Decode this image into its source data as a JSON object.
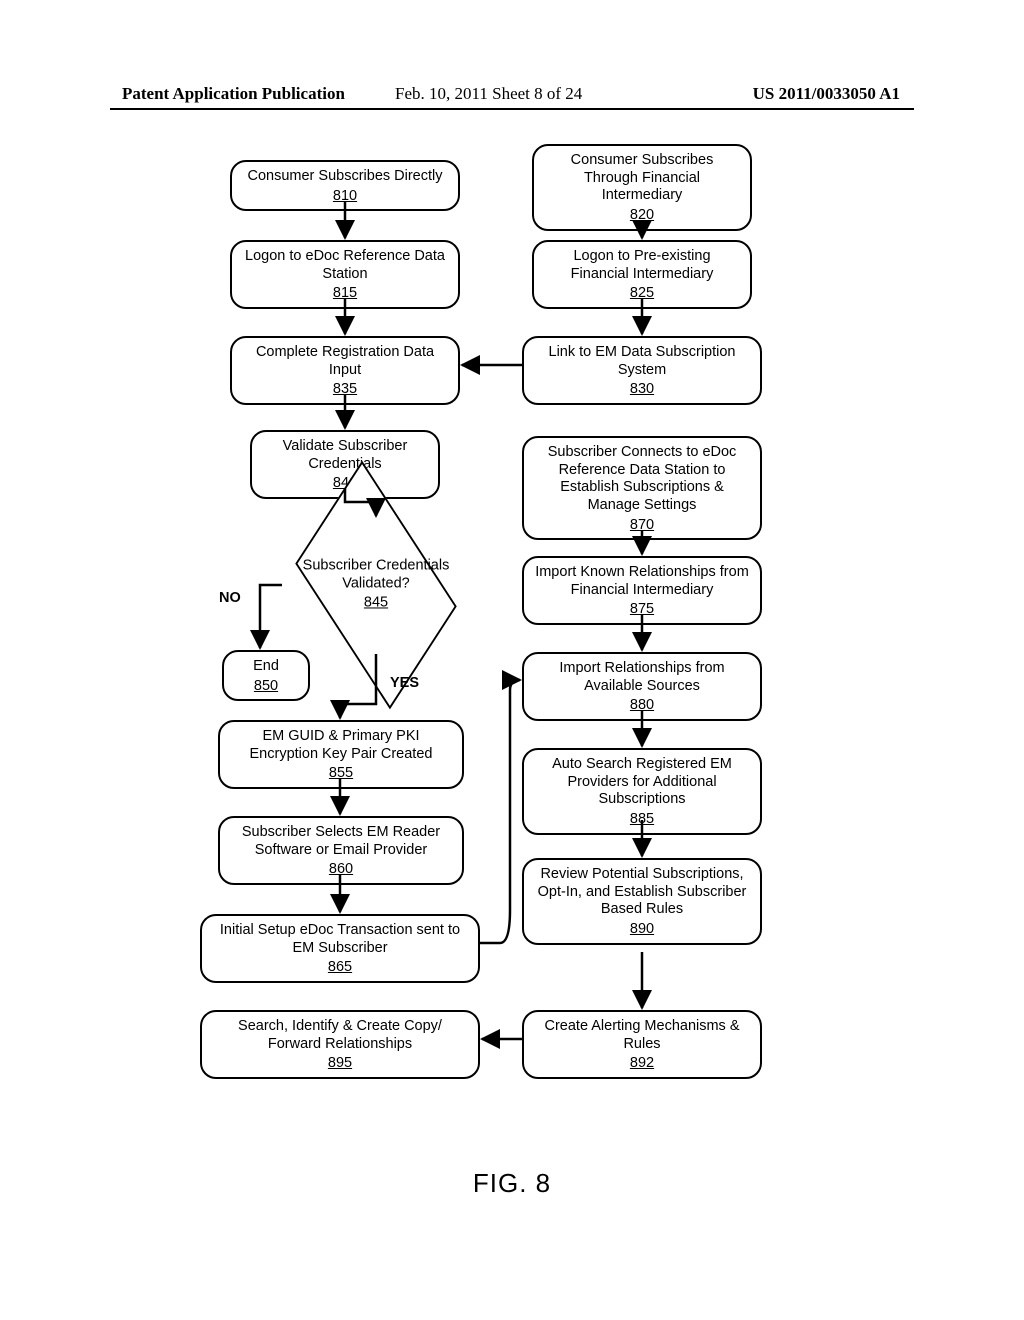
{
  "header": {
    "left": "Patent Application Publication",
    "center": "Feb. 10, 2011  Sheet 8 of 24",
    "right": "US 2011/0033050 A1"
  },
  "figure_label": "FIG. 8",
  "labels": {
    "no": "NO",
    "yes": "YES"
  },
  "boxes": {
    "b810": {
      "text": "Consumer Subscribes Directly",
      "ref": "810"
    },
    "b815": {
      "text": "Logon to eDoc Reference Data Station",
      "ref": "815"
    },
    "b820": {
      "text": "Consumer Subscribes Through Financial Intermediary",
      "ref": "820"
    },
    "b825": {
      "text": "Logon to Pre-existing Financial Intermediary",
      "ref": "825"
    },
    "b830": {
      "text": "Link to EM Data Subscription System",
      "ref": "830"
    },
    "b835": {
      "text": "Complete Registration Data Input",
      "ref": "835"
    },
    "b840": {
      "text": "Validate Subscriber Credentials",
      "ref": "840"
    },
    "b845": {
      "text": "Subscriber Credentials Validated?",
      "ref": "845"
    },
    "b850": {
      "text": "End",
      "ref": "850"
    },
    "b855": {
      "text": "EM GUID & Primary PKI Encryption Key Pair Created",
      "ref": "855"
    },
    "b860": {
      "text": "Subscriber Selects EM Reader Software or Email Provider",
      "ref": "860"
    },
    "b865": {
      "text": "Initial Setup eDoc Transaction sent to EM Subscriber",
      "ref": "865"
    },
    "b870": {
      "text": "Subscriber Connects to eDoc Reference Data Station to Establish Subscriptions & Manage Settings",
      "ref": "870"
    },
    "b875": {
      "text": "Import Known Relationships from Financial Intermediary",
      "ref": "875"
    },
    "b880": {
      "text": "Import Relationships from Available Sources",
      "ref": "880"
    },
    "b885": {
      "text": "Auto Search Registered EM Providers for Additional Subscriptions",
      "ref": "885"
    },
    "b890": {
      "text": "Review Potential Subscriptions, Opt-In, and Establish Subscriber Based Rules",
      "ref": "890"
    },
    "b892": {
      "text": "Create Alerting Mechanisms & Rules",
      "ref": "892"
    },
    "b895": {
      "text": "Search, Identify & Create Copy/ Forward Relationships",
      "ref": "895"
    }
  }
}
